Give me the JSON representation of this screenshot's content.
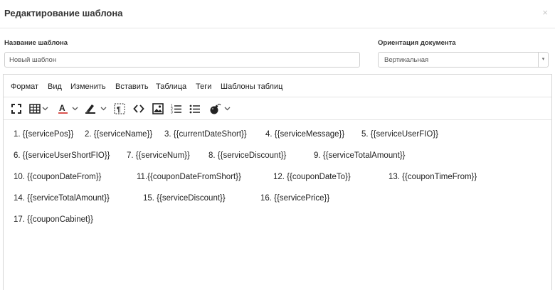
{
  "modal": {
    "title": "Редактирование шаблона",
    "close_icon": "×"
  },
  "form": {
    "name_label": "Название шаблона",
    "name_value": "Новый шаблон",
    "orientation_label": "Ориентация документа",
    "orientation_value": "Вертикальная",
    "orientation_caret": "▾"
  },
  "editor": {
    "menu": [
      "Формат",
      "Вид",
      "Изменить",
      "Вставить",
      "Таблица",
      "Теги",
      "Шаблоны таблиц"
    ],
    "toolbar_icons": [
      "fullscreen-icon",
      "table-icon",
      "text-color-icon",
      "highlight-color-icon",
      "show-blocks-icon",
      "source-code-icon",
      "image-icon",
      "numbered-list-icon",
      "bullet-list-icon",
      "bomb-icon"
    ],
    "lines": [
      [
        "1. {{servicePos}}",
        "2. {{serviceName}}",
        "3. {{currentDateShort}}",
        "4. {{serviceMessage}}",
        "5. {{serviceUserFIO}}"
      ],
      [
        "6. {{serviceUserShortFIO}}",
        "7. {{serviceNum}}",
        "8. {{serviceDiscount}}",
        "9. {{serviceTotalAmount}}"
      ],
      [
        "10. {{couponDateFrom}}",
        "11.{{couponDateFromShort}}",
        "12. {{couponDateTo}}",
        "13. {{couponTimeFrom}}"
      ],
      [
        "14. {{serviceTotalAmount}}",
        "15. {{serviceDiscount}}",
        "16. {{servicePrice}}"
      ],
      [
        "17. {{couponCabinet}}"
      ]
    ]
  },
  "colors": {
    "accent_red": "#d9534f",
    "border": "#d6d6d6"
  }
}
